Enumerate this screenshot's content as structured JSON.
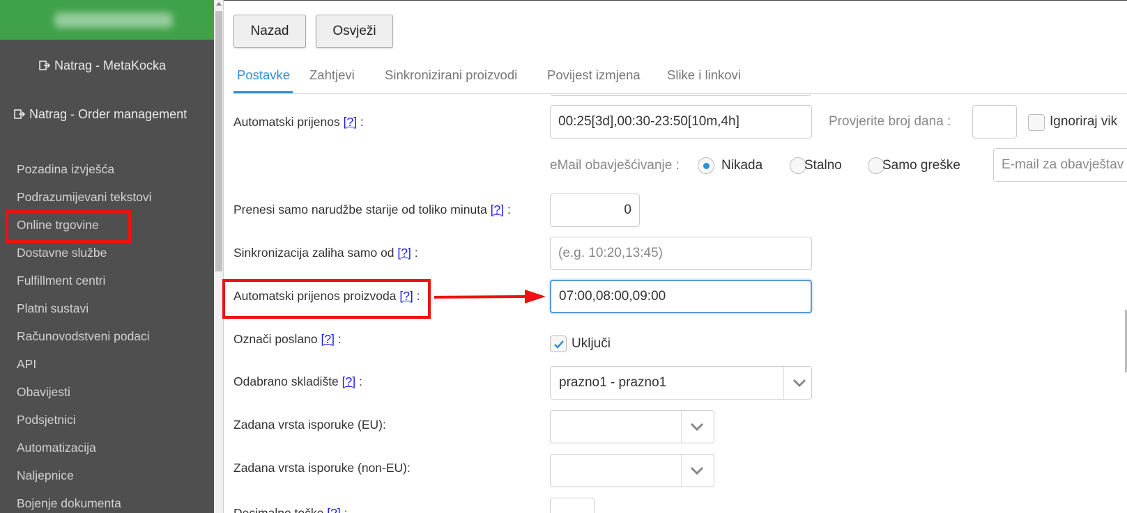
{
  "sidebar": {
    "back_metakocka": "Natrag - MetaKocka",
    "back_order_mgmt": "Natrag - Order management",
    "items": [
      {
        "label": "Pozadina izvješća"
      },
      {
        "label": "Podrazumijevani tekstovi"
      },
      {
        "label": "Online trgovine"
      },
      {
        "label": "Dostavne službe"
      },
      {
        "label": "Fulfillment centri"
      },
      {
        "label": "Platni sustavi"
      },
      {
        "label": "Računovodstveni podaci"
      },
      {
        "label": "API"
      },
      {
        "label": "Obavijesti"
      },
      {
        "label": "Podsjetnici"
      },
      {
        "label": "Automatizacija"
      },
      {
        "label": "Naljepnice"
      },
      {
        "label": "Bojenje dokumenta"
      }
    ]
  },
  "toolbar": {
    "back_label": "Nazad",
    "refresh_label": "Osvježi"
  },
  "tabs": [
    {
      "label": "Postavke"
    },
    {
      "label": "Zahtjevi"
    },
    {
      "label": "Sinkronizirani proizvodi"
    },
    {
      "label": "Povijest izmjena"
    },
    {
      "label": "Slike i linkovi"
    }
  ],
  "help_marker": "[?]",
  "form": {
    "auto_transfer": {
      "label": "Automatski prijenos",
      "value": "00:25[3d],00:30-23:50[10m,4h]",
      "check_days_label": "Provjerite broj dana :",
      "check_days_value": "",
      "ignore_label": "Ignoriraj vik"
    },
    "email_notify": {
      "label": "eMail obavješćivanje :",
      "options": [
        {
          "label": "Nikada"
        },
        {
          "label": "Stalno"
        },
        {
          "label": "Samo greške"
        }
      ],
      "selected": "Nikada",
      "email_placeholder": "E-mail za obavještav"
    },
    "older_than": {
      "label": "Prenesi samo narudžbe starije od toliko minuta",
      "value": "0"
    },
    "stock_sync": {
      "label": "Sinkronizacija zaliha samo od",
      "placeholder": "(e.g. 10:20,13:45)"
    },
    "product_transfer": {
      "label": "Automatski prijenos proizvoda",
      "value": "07:00,08:00,09:00"
    },
    "mark_sent": {
      "label": "Označi poslano",
      "checkbox_label": "Uključi",
      "checked": true
    },
    "warehouse": {
      "label": "Odabrano skladište",
      "value": "prazno1 - prazno1"
    },
    "delivery_eu": {
      "label": "Zadana vrsta isporuke (EU):",
      "value": ""
    },
    "delivery_non_eu": {
      "label": "Zadana vrsta isporuke (non-EU):",
      "value": ""
    },
    "decimal_points": {
      "label": "Decimalne točke",
      "value": ""
    }
  },
  "colors": {
    "accent": "#2f8fd8",
    "sidebar_bg": "#4f4f4f",
    "header_green": "#3fa24a",
    "highlight_red": "#ee1111"
  }
}
